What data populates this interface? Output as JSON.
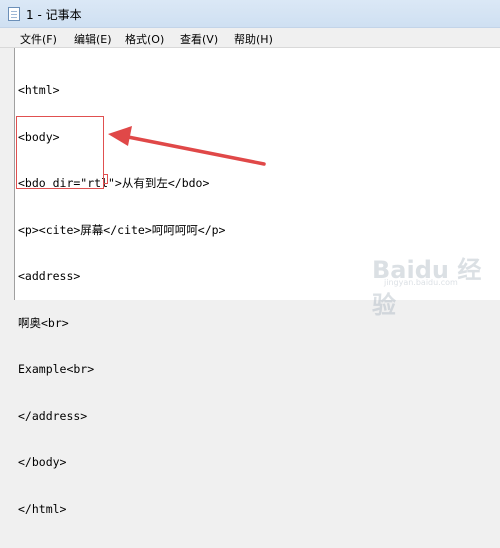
{
  "window": {
    "title": "1 - 记事本"
  },
  "menu": [
    "文件(F)",
    "编辑(E)",
    "格式(O)",
    "查看(V)",
    "帮助(H)"
  ],
  "editor": {
    "lines": [
      "<html>",
      "<body>",
      "<bdo dir=\"rtl\">从有到左</bdo>",
      "<p><cite>屏幕</cite>呵呵呵呵</p>",
      "<address>",
      "啊奥<br>",
      "Example<br>",
      "</address>",
      "</body>",
      "</html>"
    ]
  },
  "annotation": {
    "color": "#e04848"
  },
  "watermark": {
    "text": "Baidu 经验",
    "sub": "jingyan.baidu.com"
  }
}
